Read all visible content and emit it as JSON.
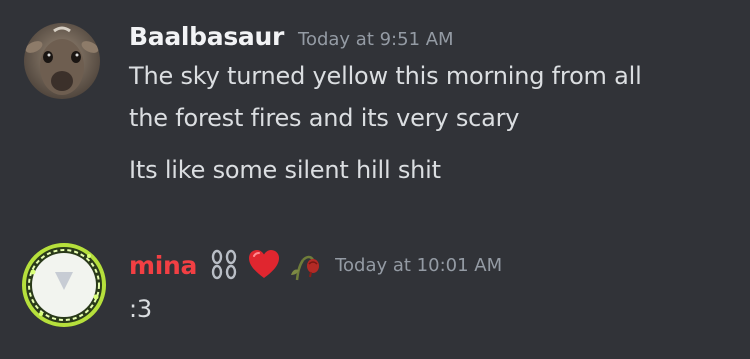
{
  "messages": [
    {
      "author": "Baalbasaur",
      "timestamp": "Today at 9:51 AM",
      "author_color": "#f2f3f5",
      "avatar": "deer-face-avatar",
      "lines": [
        "The sky turned yellow this morning from all",
        "the forest fires and its very scary",
        "Its like some silent hill shit"
      ]
    },
    {
      "author": "mina",
      "timestamp": "Today at 10:01 AM",
      "author_color": "#f23f43",
      "avatar": "green-ring-avatar",
      "name_emojis": [
        "chain-icon",
        "red-heart-icon",
        "wilted-rose-icon"
      ],
      "lines": [
        ":3"
      ]
    }
  ],
  "colors": {
    "background": "#313338",
    "text": "#dbdee1",
    "timestamp": "#949ba4"
  }
}
